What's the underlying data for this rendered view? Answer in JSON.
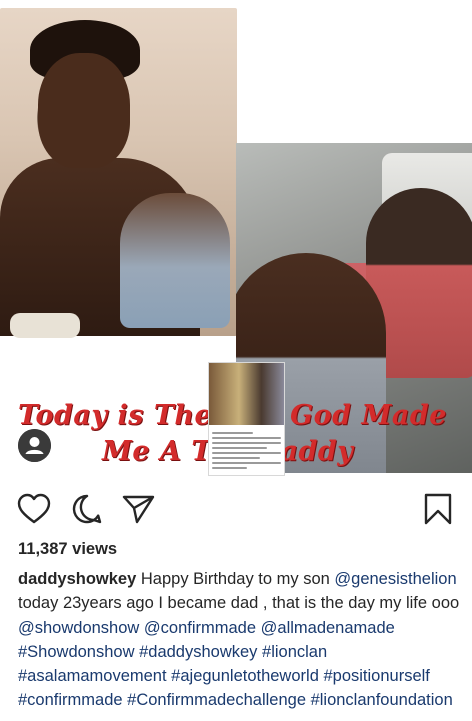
{
  "post": {
    "tagline_line1": "Today is The Day God Made",
    "tagline_line2": "Me A Tag Daddy",
    "views": "11,387 views",
    "username": "daddyshowkey",
    "caption_text": "Happy Birthday to my son",
    "caption_mention1": "@genesisthelion",
    "caption_text2": "today 23years ago I became dad , that is the day my life ooo",
    "caption_mention2": "@showdonshow",
    "caption_mention3": "@confirmmade",
    "caption_mention4": "@allmadenamade",
    "hashtags_line1": [
      "#Showdonshow"
    ],
    "hashtags_line2": [
      "#daddyshowkey",
      "#lionclan",
      "#asalamamovement"
    ],
    "hashtags_line3": [
      "#ajegunletotheworld",
      "#positionurself",
      "#confirmmade"
    ],
    "hashtags_line4": "#Confirmmadechallenge #lionclanfoundation"
  },
  "icons": {
    "like": "heart-outline-icon",
    "comment": "comment-bubble-icon",
    "share": "paper-plane-icon",
    "save": "bookmark-icon",
    "avatar": "user-avatar-icon"
  },
  "colors": {
    "tagline": "#d32b2b",
    "hashtag": "#1a3a6e",
    "text": "#262626"
  }
}
